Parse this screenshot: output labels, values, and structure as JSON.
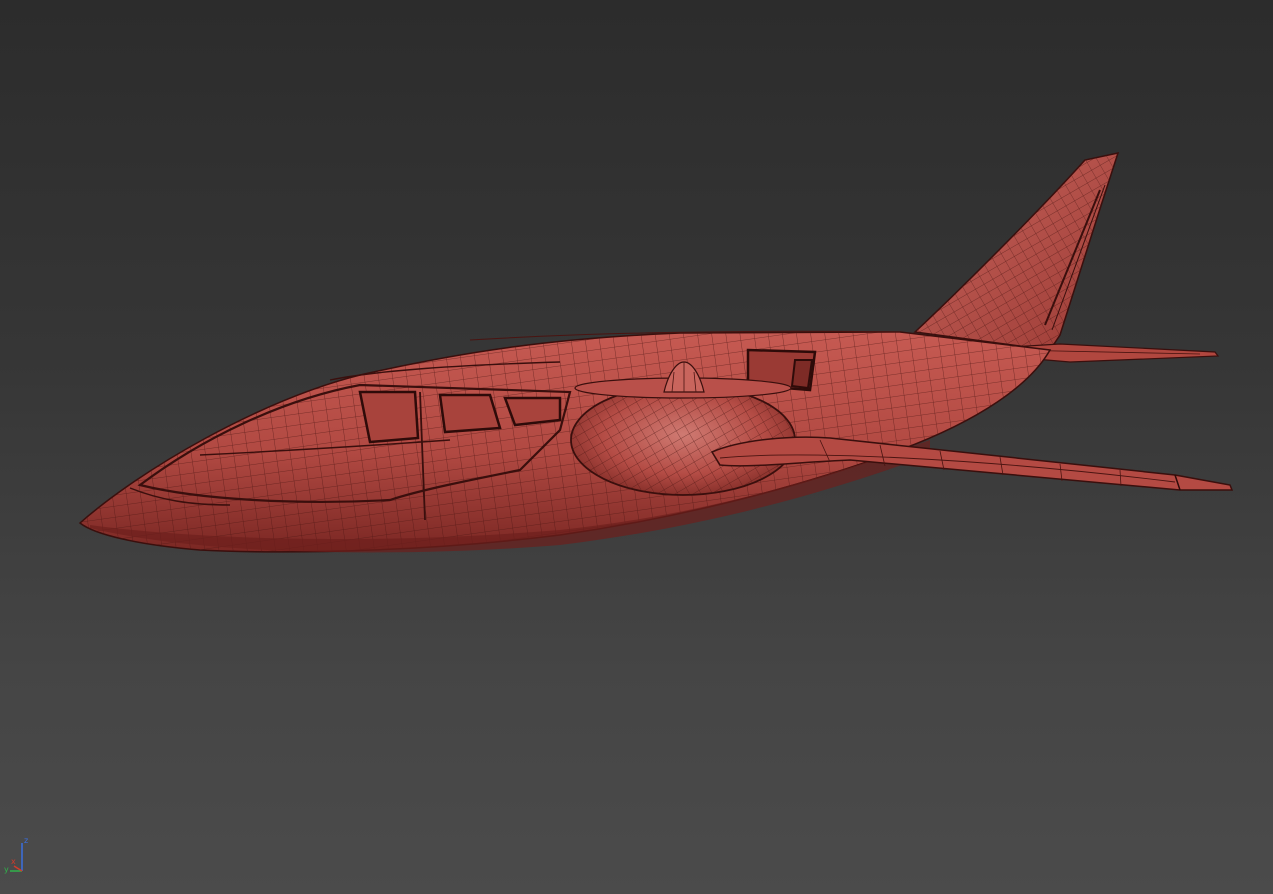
{
  "viewport": {
    "background_top": "#2c2c2c",
    "background_bottom": "#4b4b4b"
  },
  "model": {
    "subject": "aircraft",
    "shading": "wireframe-on-shaded",
    "surface_color": "#b9504a",
    "wire_color": "#3a0f0d"
  },
  "gizmo": {
    "z_label": "z",
    "x_label": "x",
    "y_label": "y",
    "x_color": "#d23a2a",
    "y_color": "#2fb34a",
    "z_color": "#3a6fe0"
  }
}
